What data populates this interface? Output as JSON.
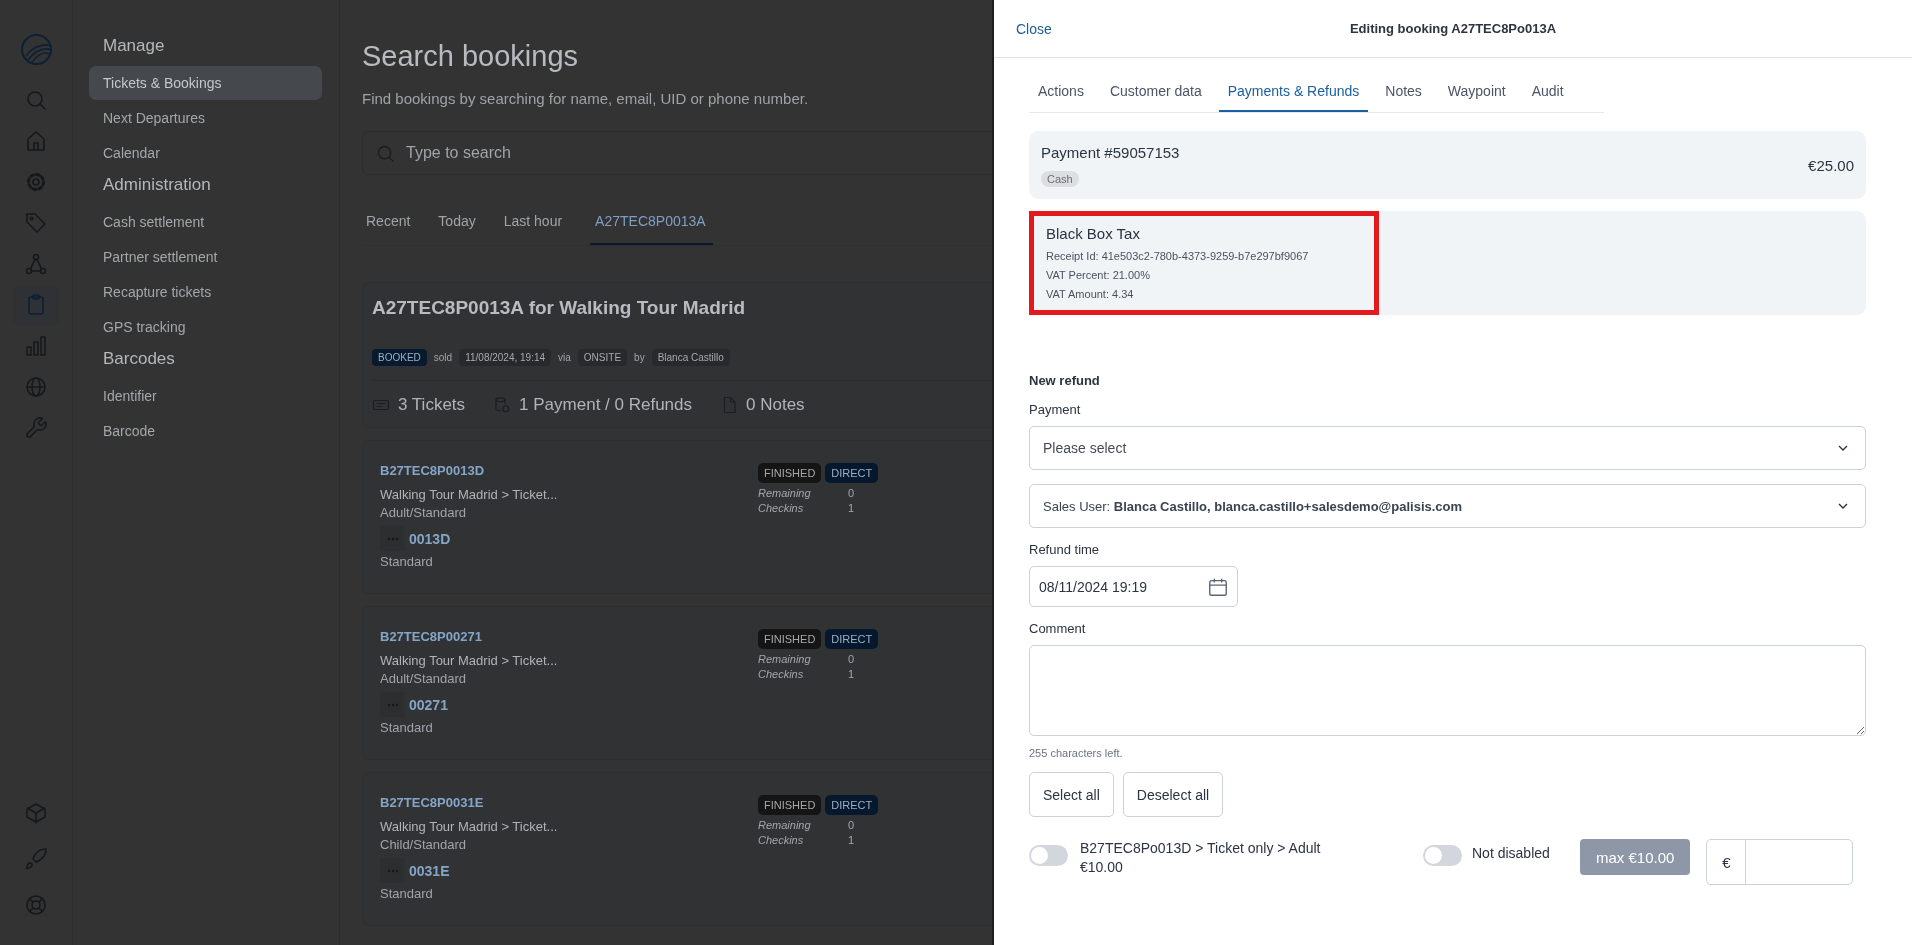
{
  "rail": {
    "top": [
      {
        "kind": "search",
        "selected": false
      },
      {
        "kind": "home",
        "selected": false
      },
      {
        "kind": "gear",
        "selected": false
      },
      {
        "kind": "tag",
        "selected": false
      },
      {
        "kind": "network",
        "selected": false
      },
      {
        "kind": "clipboard",
        "selected": true
      },
      {
        "kind": "chart",
        "selected": false
      },
      {
        "kind": "globe",
        "selected": false
      },
      {
        "kind": "wrench",
        "selected": false
      }
    ],
    "bottom": [
      {
        "kind": "cube",
        "selected": false
      },
      {
        "kind": "rocket",
        "selected": false
      },
      {
        "kind": "lifebuoy",
        "selected": false
      }
    ]
  },
  "nav": [
    {
      "title": "Manage",
      "items": [
        {
          "label": "Tickets & Bookings",
          "selected": true
        },
        {
          "label": "Next Departures",
          "selected": false
        },
        {
          "label": "Calendar",
          "selected": false
        }
      ]
    },
    {
      "title": "Administration",
      "items": [
        {
          "label": "Cash settlement",
          "selected": false
        },
        {
          "label": "Partner settlement",
          "selected": false
        },
        {
          "label": "Recapture tickets",
          "selected": false
        },
        {
          "label": "GPS tracking",
          "selected": false
        }
      ]
    },
    {
      "title": "Barcodes",
      "items": [
        {
          "label": "Identifier",
          "selected": false
        },
        {
          "label": "Barcode",
          "selected": false
        }
      ]
    }
  ],
  "main": {
    "title": "Search bookings",
    "subtitle": "Find bookings by searching for name, email, UID or phone number.",
    "search": {
      "placeholder": "Type to search"
    },
    "tabs": [
      {
        "label": "Recent",
        "selected": false
      },
      {
        "label": "Today",
        "selected": false
      },
      {
        "label": "Last hour",
        "selected": false
      },
      {
        "label": "A27TEC8P0013A",
        "selected": true
      }
    ],
    "booking": {
      "title": "A27TEC8P0013A for Walking Tour Madrid",
      "status": "BOOKED",
      "sold_label": "sold",
      "date": "11/08/2024, 19:14",
      "via_label": "via",
      "channel": "ONSITE",
      "by_label": "by",
      "seller": "Blanca Castillo",
      "stats": [
        {
          "kind": "tickets",
          "text": "3 Tickets"
        },
        {
          "kind": "payments",
          "text": "1 Payment / 0 Refunds"
        },
        {
          "kind": "notes",
          "text": "0 Notes"
        }
      ]
    },
    "tickets": [
      {
        "code": "B27TEC8P0013D",
        "product": "Walking Tour Madrid > Ticket...",
        "variant": "Adult/Standard",
        "short_code": "0013D",
        "category": "Standard",
        "badges": [
          {
            "label": "FINISHED",
            "kind": "status"
          },
          {
            "label": "DIRECT",
            "kind": "channel"
          }
        ],
        "remaining_label": "Remaining",
        "remaining": "0",
        "checkins_label": "Checkins",
        "checkins": "1"
      },
      {
        "code": "B27TEC8P00271",
        "product": "Walking Tour Madrid > Ticket...",
        "variant": "Adult/Standard",
        "short_code": "00271",
        "category": "Standard",
        "badges": [
          {
            "label": "FINISHED",
            "kind": "status"
          },
          {
            "label": "DIRECT",
            "kind": "channel"
          }
        ],
        "remaining_label": "Remaining",
        "remaining": "0",
        "checkins_label": "Checkins",
        "checkins": "1"
      },
      {
        "code": "B27TEC8P0031E",
        "product": "Walking Tour Madrid > Ticket...",
        "variant": "Child/Standard",
        "short_code": "0031E",
        "category": "Standard",
        "badges": [
          {
            "label": "FINISHED",
            "kind": "status"
          },
          {
            "label": "DIRECT",
            "kind": "channel"
          }
        ],
        "remaining_label": "Remaining",
        "remaining": "0",
        "checkins_label": "Checkins",
        "checkins": "1"
      }
    ]
  },
  "panel": {
    "close": "Close",
    "title": "Editing booking A27TEC8Po013A",
    "tabs": [
      {
        "label": "Actions",
        "selected": false
      },
      {
        "label": "Customer data",
        "selected": false
      },
      {
        "label": "Payments & Refunds",
        "selected": true
      },
      {
        "label": "Notes",
        "selected": false
      },
      {
        "label": "Waypoint",
        "selected": false
      },
      {
        "label": "Audit",
        "selected": false
      }
    ],
    "payment": {
      "title": "Payment #59057153",
      "method": "Cash",
      "amount": "€25.00"
    },
    "tax": {
      "title": "Black Box Tax",
      "highlighted": true,
      "lines": [
        "Receipt Id: 41e503c2-780b-4373-9259-b7e297bf9067",
        "VAT Percent: 21.00%",
        "VAT Amount: 4.34"
      ]
    },
    "refund": {
      "heading": "New refund",
      "payment_label": "Payment",
      "payment_placeholder": "Please select",
      "sales_user": "Sales User: **Blanca Castillo, blanca.castillo+salesdemo@palisis.com**",
      "time_label": "Refund time",
      "time_value": "08/11/2024 19:19",
      "comment_label": "Comment",
      "chars_left": "255 characters left.",
      "buttons": [
        "Select all",
        "Deselect all"
      ],
      "items": [
        {
          "label": "B27TEC8Po013D > Ticket only > Adult",
          "price": "€10.00",
          "on": false,
          "disabled_toggle_on": false,
          "disabled_label": "Not disabled",
          "max": "max €10.00",
          "currency": "€"
        }
      ]
    }
  }
}
